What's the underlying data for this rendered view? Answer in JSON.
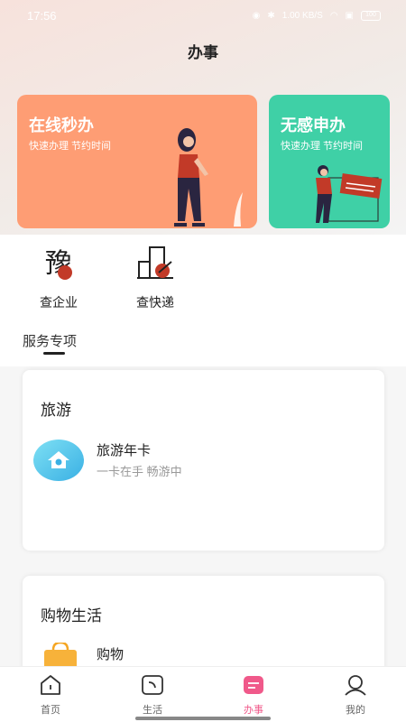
{
  "status_bar": {
    "time": "17:56",
    "network_speed": "1.00 KB/S",
    "battery": "100"
  },
  "header": {
    "title": "办事"
  },
  "banners": [
    {
      "title": "在线秒办",
      "subtitle": "快速办理 节约时间",
      "color": "#fe9d74"
    },
    {
      "title": "无感申办",
      "subtitle": "快速办理 节约时间",
      "color": "#3fd0a6"
    }
  ],
  "quick_actions": [
    {
      "label": "查企业",
      "icon": "enterprise-seal-icon"
    },
    {
      "label": "查快递",
      "icon": "courier-building-icon"
    }
  ],
  "section": {
    "title": "服务专项"
  },
  "categories": [
    {
      "title": "旅游",
      "items": [
        {
          "name": "旅游年卡",
          "desc": "一卡在手 畅游中",
          "icon": "travel-card-icon"
        }
      ]
    },
    {
      "title": "购物生活",
      "items": [
        {
          "name": "购物",
          "icon": "shopping-bag-icon"
        }
      ]
    }
  ],
  "tabs": [
    {
      "label": "首页",
      "icon": "home-icon"
    },
    {
      "label": "生活",
      "icon": "life-icon"
    },
    {
      "label": "办事",
      "icon": "affairs-icon",
      "active": true
    },
    {
      "label": "我的",
      "icon": "profile-icon"
    }
  ],
  "colors": {
    "accent": "#f0598a",
    "orange": "#fe9d74",
    "green": "#3fd0a6"
  }
}
